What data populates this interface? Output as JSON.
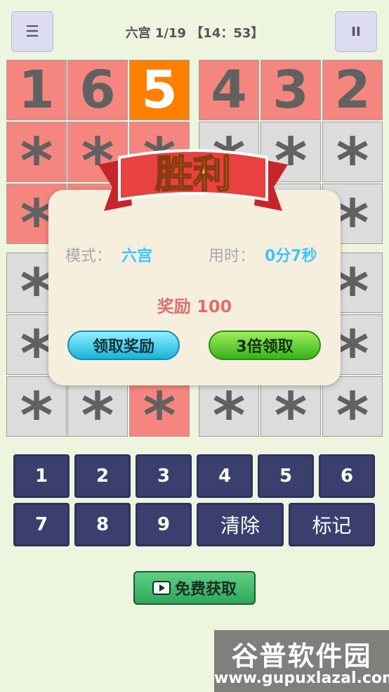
{
  "header": {
    "menu_icon": "☰",
    "title": "六宫 1/19 【14：53】",
    "pause_icon": "II"
  },
  "board": {
    "rows": [
      [
        {
          "v": "1",
          "c": "red"
        },
        {
          "v": "6",
          "c": "red"
        },
        {
          "v": "5",
          "c": "orange"
        },
        {
          "v": "4",
          "c": "red"
        },
        {
          "v": "3",
          "c": "red"
        },
        {
          "v": "2",
          "c": "red"
        }
      ],
      [
        {
          "v": "*",
          "c": "red"
        },
        {
          "v": "*",
          "c": "red"
        },
        {
          "v": "*",
          "c": "red"
        },
        {
          "v": "*",
          "c": "gray"
        },
        {
          "v": "*",
          "c": "gray"
        },
        {
          "v": "*",
          "c": "gray"
        }
      ],
      [
        {
          "v": "*",
          "c": "red"
        },
        {
          "v": "*",
          "c": "red"
        },
        {
          "v": "*",
          "c": "red"
        },
        {
          "v": "*",
          "c": "gray"
        },
        {
          "v": "*",
          "c": "gray"
        },
        {
          "v": "*",
          "c": "gray"
        }
      ],
      [
        {
          "v": "*",
          "c": "gray"
        },
        {
          "v": "*",
          "c": "gray"
        },
        {
          "v": "*",
          "c": "red"
        },
        {
          "v": "*",
          "c": "gray"
        },
        {
          "v": "*",
          "c": "gray"
        },
        {
          "v": "*",
          "c": "gray"
        }
      ],
      [
        {
          "v": "*",
          "c": "gray"
        },
        {
          "v": "*",
          "c": "gray"
        },
        {
          "v": "*",
          "c": "red"
        },
        {
          "v": "*",
          "c": "gray"
        },
        {
          "v": "*",
          "c": "gray"
        },
        {
          "v": "*",
          "c": "gray"
        }
      ],
      [
        {
          "v": "*",
          "c": "gray"
        },
        {
          "v": "*",
          "c": "gray"
        },
        {
          "v": "*",
          "c": "red"
        },
        {
          "v": "*",
          "c": "gray"
        },
        {
          "v": "*",
          "c": "gray"
        },
        {
          "v": "*",
          "c": "gray"
        }
      ]
    ]
  },
  "keypad": {
    "numbers": [
      "1",
      "2",
      "3",
      "4",
      "5",
      "6",
      "7",
      "8",
      "9"
    ],
    "clear_label": "清除",
    "mark_label": "标记"
  },
  "free_button": {
    "label": "免费获取",
    "icon": "video-icon"
  },
  "dialog": {
    "banner_title": "胜利",
    "mode_label": "模式：",
    "mode_value": "六宫",
    "time_label": "用时：",
    "time_value": "0分7秒",
    "reward_text": "奖励 100",
    "claim_label": "领取奖励",
    "triple_label": "3倍领取"
  },
  "watermark": {
    "title": "谷普软件园",
    "url": "www.gupuxlazal.com"
  }
}
